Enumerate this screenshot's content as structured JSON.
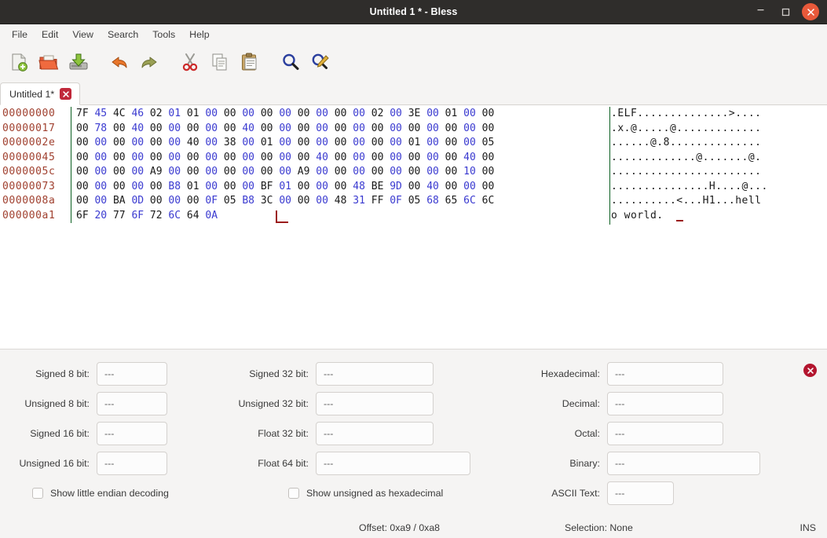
{
  "window": {
    "title": "Untitled 1 * - Bless",
    "minimize_label": "–",
    "maximize_label": "□",
    "close_label": "✕"
  },
  "menubar": {
    "items": [
      {
        "label": "File"
      },
      {
        "label": "Edit"
      },
      {
        "label": "View"
      },
      {
        "label": "Search"
      },
      {
        "label": "Tools"
      },
      {
        "label": "Help"
      }
    ]
  },
  "toolbar": {
    "buttons": [
      {
        "name": "new-file-icon",
        "tooltip": "New"
      },
      {
        "name": "open-folder-icon",
        "tooltip": "Open"
      },
      {
        "name": "save-icon",
        "tooltip": "Save"
      },
      {
        "name": "undo-icon",
        "tooltip": "Undo"
      },
      {
        "name": "redo-icon",
        "tooltip": "Redo"
      },
      {
        "name": "cut-icon",
        "tooltip": "Cut"
      },
      {
        "name": "copy-icon",
        "tooltip": "Copy"
      },
      {
        "name": "paste-icon",
        "tooltip": "Paste"
      },
      {
        "name": "find-icon",
        "tooltip": "Find"
      },
      {
        "name": "find-replace-icon",
        "tooltip": "Find and Replace"
      }
    ]
  },
  "tabs": [
    {
      "label": "Untitled 1*",
      "close_label": "✕",
      "active": true
    }
  ],
  "hexview": {
    "bytes_per_row": 23,
    "rows": [
      {
        "offset": "00000000",
        "bytes": [
          "7F",
          "45",
          "4C",
          "46",
          "02",
          "01",
          "01",
          "00",
          "00",
          "00",
          "00",
          "00",
          "00",
          "00",
          "00",
          "00",
          "02",
          "00",
          "3E",
          "00",
          "01",
          "00",
          "00"
        ],
        "ascii": ".ELF..............>...."
      },
      {
        "offset": "00000017",
        "bytes": [
          "00",
          "78",
          "00",
          "40",
          "00",
          "00",
          "00",
          "00",
          "00",
          "40",
          "00",
          "00",
          "00",
          "00",
          "00",
          "00",
          "00",
          "00",
          "00",
          "00",
          "00",
          "00",
          "00"
        ],
        "ascii": ".x.@.....@............."
      },
      {
        "offset": "0000002e",
        "bytes": [
          "00",
          "00",
          "00",
          "00",
          "00",
          "00",
          "40",
          "00",
          "38",
          "00",
          "01",
          "00",
          "00",
          "00",
          "00",
          "00",
          "00",
          "00",
          "01",
          "00",
          "00",
          "00",
          "05"
        ],
        "ascii": "......@.8.............."
      },
      {
        "offset": "00000045",
        "bytes": [
          "00",
          "00",
          "00",
          "00",
          "00",
          "00",
          "00",
          "00",
          "00",
          "00",
          "00",
          "00",
          "00",
          "40",
          "00",
          "00",
          "00",
          "00",
          "00",
          "00",
          "00",
          "40",
          "00"
        ],
        "ascii": ".............@.......@."
      },
      {
        "offset": "0000005c",
        "bytes": [
          "00",
          "00",
          "00",
          "00",
          "A9",
          "00",
          "00",
          "00",
          "00",
          "00",
          "00",
          "00",
          "A9",
          "00",
          "00",
          "00",
          "00",
          "00",
          "00",
          "00",
          "00",
          "10",
          "00"
        ],
        "ascii": "......................."
      },
      {
        "offset": "00000073",
        "bytes": [
          "00",
          "00",
          "00",
          "00",
          "00",
          "B8",
          "01",
          "00",
          "00",
          "00",
          "BF",
          "01",
          "00",
          "00",
          "00",
          "48",
          "BE",
          "9D",
          "00",
          "40",
          "00",
          "00",
          "00"
        ],
        "ascii": "...............H....@..."
      },
      {
        "offset": "0000008a",
        "bytes": [
          "00",
          "00",
          "BA",
          "0D",
          "00",
          "00",
          "00",
          "0F",
          "05",
          "B8",
          "3C",
          "00",
          "00",
          "00",
          "48",
          "31",
          "FF",
          "0F",
          "05",
          "68",
          "65",
          "6C",
          "6C"
        ],
        "ascii": "..........<...H1...hell"
      },
      {
        "offset": "000000a1",
        "bytes": [
          "6F",
          "20",
          "77",
          "6F",
          "72",
          "6C",
          "64",
          "0A"
        ],
        "ascii": "o world."
      }
    ],
    "colors": {
      "offset": "#a0402f",
      "byte_even": "#1a1a1a",
      "byte_odd": "#3a3ad0",
      "separator": "#0b5f21",
      "cursor": "#9b1c1c",
      "background": "#ffffff"
    }
  },
  "decode_panel": {
    "empty_value": "---",
    "close_label": "✕",
    "column_left": {
      "fields": [
        {
          "label": "Signed 8 bit:",
          "value": "---"
        },
        {
          "label": "Unsigned 8 bit:",
          "value": "---"
        },
        {
          "label": "Signed 16 bit:",
          "value": "---"
        },
        {
          "label": "Unsigned 16 bit:",
          "value": "---"
        }
      ],
      "checkbox": {
        "label": "Show little endian decoding",
        "checked": false
      }
    },
    "column_middle": {
      "fields": [
        {
          "label": "Signed 32 bit:",
          "value": "---"
        },
        {
          "label": "Unsigned 32 bit:",
          "value": "---"
        },
        {
          "label": "Float 32 bit:",
          "value": "---"
        },
        {
          "label": "Float 64 bit:",
          "value": "---"
        }
      ],
      "checkbox": {
        "label": "Show unsigned as hexadecimal",
        "checked": false
      }
    },
    "column_right": {
      "fields": [
        {
          "label": "Hexadecimal:",
          "value": "---"
        },
        {
          "label": "Decimal:",
          "value": "---"
        },
        {
          "label": "Octal:",
          "value": "---"
        },
        {
          "label": "Binary:",
          "value": "---"
        },
        {
          "label": "ASCII Text:",
          "value": "---"
        }
      ]
    }
  },
  "statusbar": {
    "offset": "Offset: 0xa9 / 0xa8",
    "selection": "Selection: None",
    "mode": "INS"
  }
}
